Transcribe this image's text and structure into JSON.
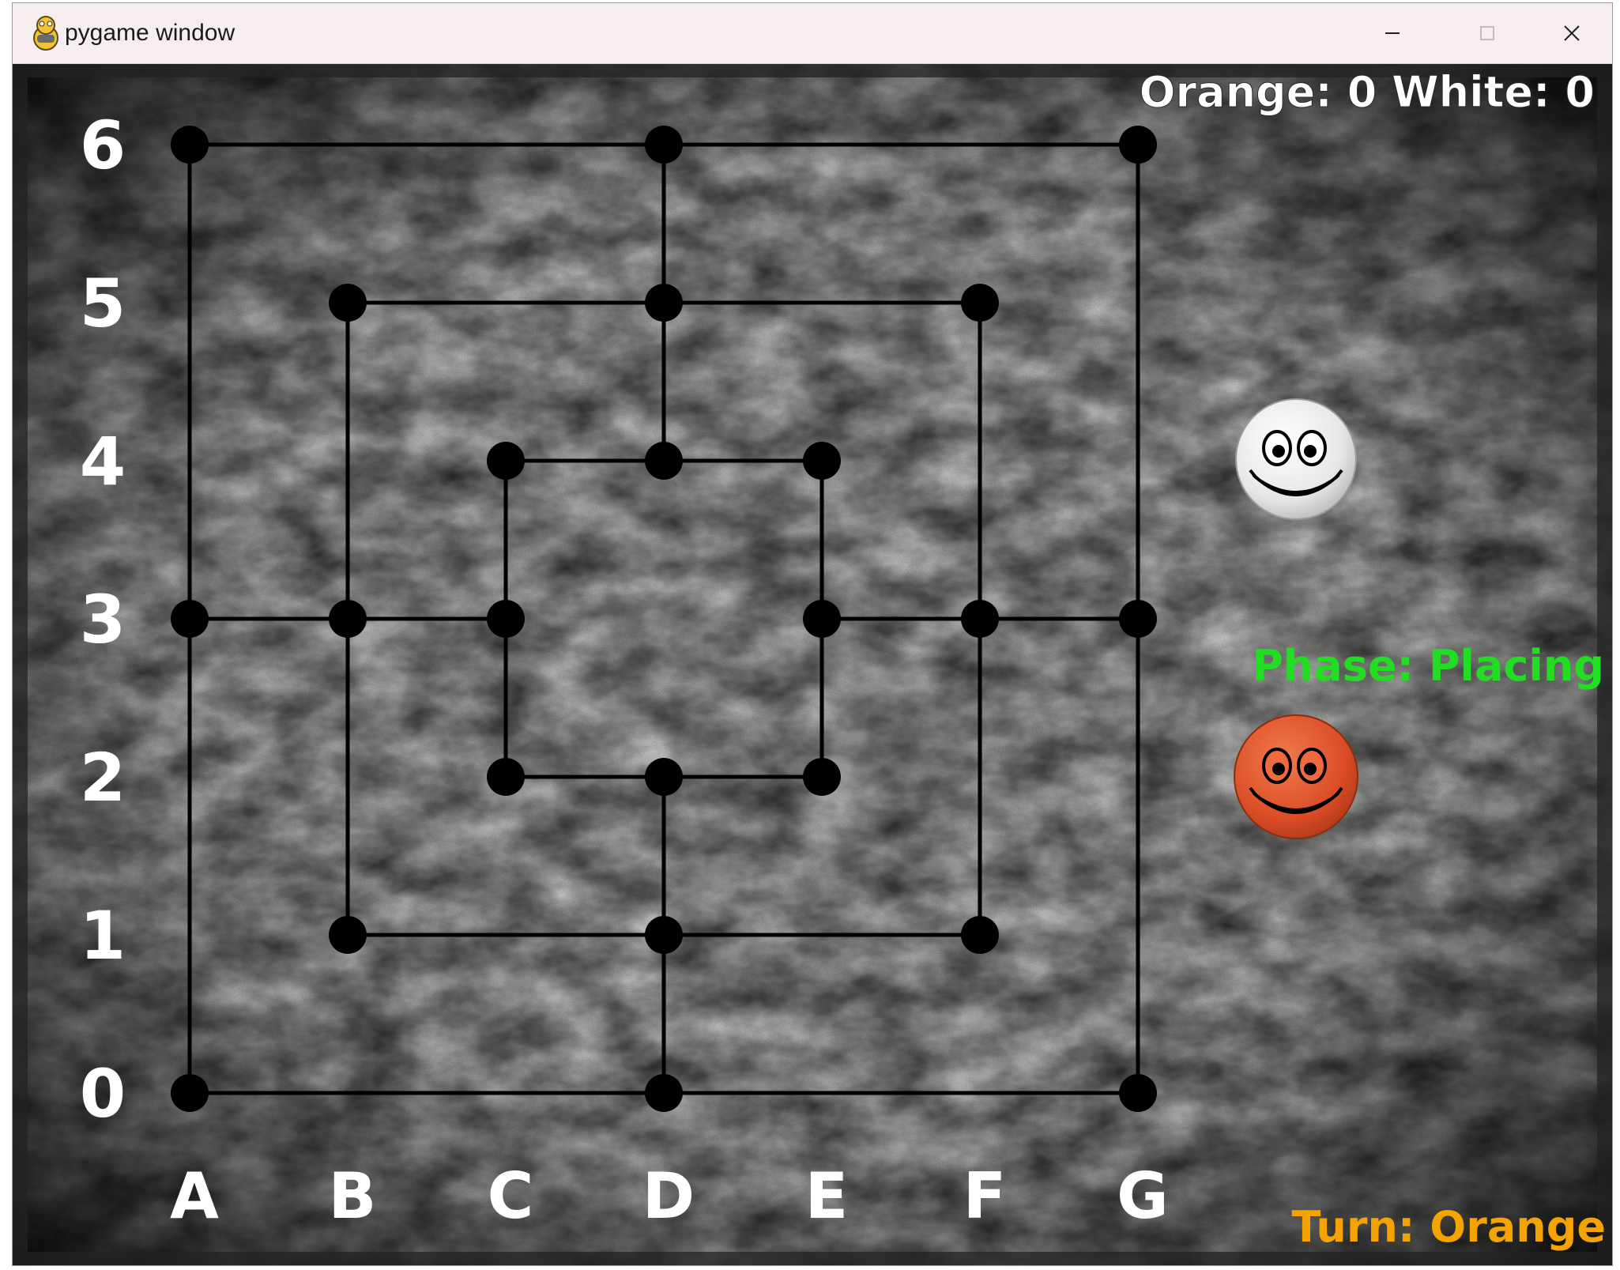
{
  "window": {
    "title": "pygame window",
    "controls": {
      "minimize_icon": "minimize-icon",
      "maximize_icon": "maximize-icon",
      "close_icon": "close-icon"
    }
  },
  "board": {
    "columns": [
      "A",
      "B",
      "C",
      "D",
      "E",
      "F",
      "G"
    ],
    "rows": [
      "6",
      "5",
      "4",
      "3",
      "2",
      "1",
      "0"
    ],
    "points": [
      "A6",
      "D6",
      "G6",
      "B5",
      "D5",
      "F5",
      "C4",
      "D4",
      "E4",
      "A3",
      "B3",
      "C3",
      "E3",
      "F3",
      "G3",
      "C2",
      "D2",
      "E2",
      "B1",
      "D1",
      "F1",
      "A0",
      "D0",
      "G0"
    ],
    "colors": {
      "line": "#000000",
      "point": "#000000",
      "label": "#ffffff"
    }
  },
  "hud": {
    "score": "Orange: 0  White: 0",
    "phase": "Phase: Placing",
    "turn": "Turn: Orange",
    "colors": {
      "score": "#ffffff",
      "phase": "#22dd22",
      "turn": "#f5a300"
    }
  },
  "pieces": {
    "white": {
      "name": "white-smiley-piece",
      "color": "#f2f2f2"
    },
    "orange": {
      "name": "orange-smiley-piece",
      "color": "#e2502b"
    }
  }
}
